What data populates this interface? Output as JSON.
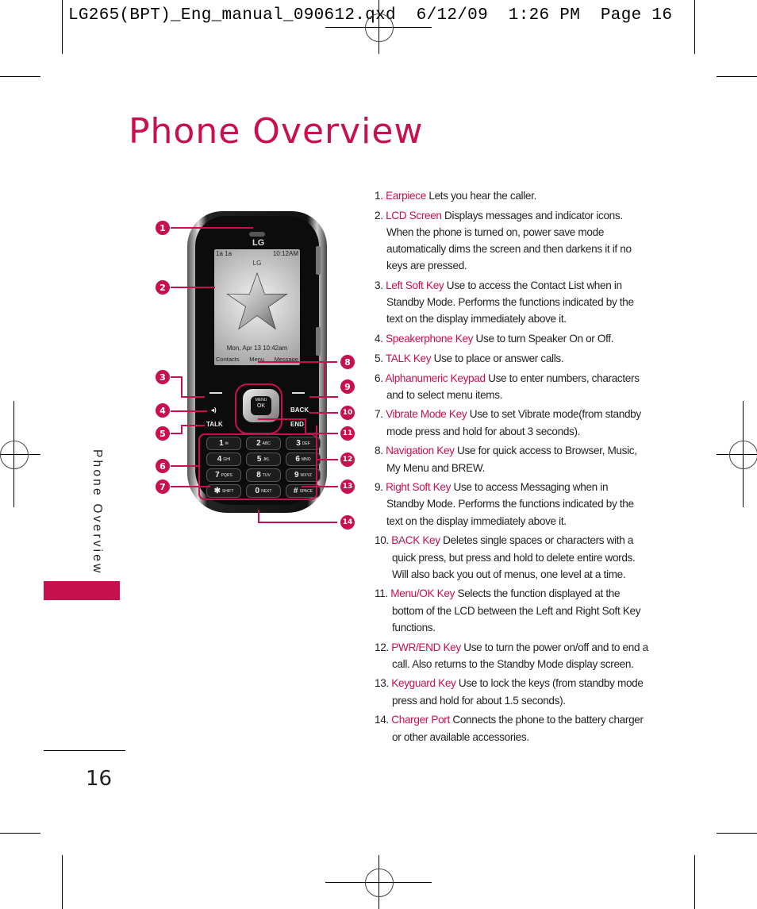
{
  "slug": "LG265(BPT)_Eng_manual_090612.qxd  6/12/09  1:26 PM  Page 16",
  "page": {
    "title": "Phone Overview",
    "side_label": "Phone Overview",
    "page_number": "16",
    "accent_color": "#c8104e"
  },
  "phone_screen": {
    "status_left": "1a  1a",
    "status_right": "10:12AM",
    "carrier": "LG",
    "date_time": "Mon, Apr 13   10:42am",
    "soft_left": "Contacts",
    "soft_center": "Menu",
    "soft_right": "Message",
    "logo": "LG"
  },
  "phone_keys": {
    "talk": "TALK",
    "back": "BACK",
    "end": "END",
    "ok_top": "MENU",
    "ok": "OK",
    "rows": [
      [
        {
          "d": "1",
          "l": "✉"
        },
        {
          "d": "2",
          "l": "ABC"
        },
        {
          "d": "3",
          "l": "DEF"
        }
      ],
      [
        {
          "d": "4",
          "l": "GHI"
        },
        {
          "d": "5",
          "l": "JKL"
        },
        {
          "d": "6",
          "l": "MNO"
        }
      ],
      [
        {
          "d": "7",
          "l": "PQRS"
        },
        {
          "d": "8",
          "l": "TUV"
        },
        {
          "d": "9",
          "l": "WXYZ"
        }
      ],
      [
        {
          "d": "✱",
          "l": "SHIFT"
        },
        {
          "d": "0",
          "l": "NEXT"
        },
        {
          "d": "#",
          "l": "SPACE"
        }
      ]
    ]
  },
  "callouts": [
    "1",
    "2",
    "3",
    "4",
    "5",
    "6",
    "7",
    "8",
    "9",
    "10",
    "11",
    "12",
    "13",
    "14"
  ],
  "items": [
    {
      "num": "1.",
      "term": "Earpiece",
      "desc": " Lets you hear the caller."
    },
    {
      "num": "2.",
      "term": "LCD Screen",
      "desc": " Displays messages and indicator icons. When the phone is turned on, power save mode automatically dims the screen and then darkens it if no keys are pressed."
    },
    {
      "num": "3.",
      "term": "Left Soft Key",
      "desc": " Use to access the Contact List when in Standby Mode. Performs the functions indicated by the text on the display immediately above it."
    },
    {
      "num": "4.",
      "term": "Speakerphone Key",
      "desc": " Use to turn Speaker On or Off."
    },
    {
      "num": "5.",
      "term": "TALK Key",
      "desc": " Use to place or answer calls."
    },
    {
      "num": "6.",
      "term": "Alphanumeric Keypad",
      "desc": " Use to enter numbers, characters and to select menu items."
    },
    {
      "num": "7.",
      "term": "Vibrate Mode Key",
      "desc": " Use to set Vibrate mode(from standby mode press and hold for about 3 seconds)."
    },
    {
      "num": "8.",
      "term": "Navigation Key",
      "desc": " Use for quick access to Browser, Music, My Menu and BREW."
    },
    {
      "num": "9.",
      "term": "Right Soft Key",
      "desc": " Use to access Messaging when in Standby Mode. Performs the functions indicated by the text on the display immediately above it."
    },
    {
      "num": "10.",
      "term": "BACK Key",
      "desc": " Deletes single spaces or characters with a quick press, but press and hold to delete entire words. Will also back you out of menus, one level at a time."
    },
    {
      "num": "11.",
      "term": "Menu/OK Key",
      "desc": " Selects the function displayed at the bottom of the LCD between the Left and Right Soft Key functions."
    },
    {
      "num": "12.",
      "term": "PWR/END Key",
      "desc": " Use to turn the power on/off and to end a call. Also returns to the Standby Mode display screen."
    },
    {
      "num": "13.",
      "term": "Keyguard Key",
      "desc": " Use to lock the keys (from standby mode press and hold for about 1.5 seconds)."
    },
    {
      "num": "14.",
      "term": "Charger Port",
      "desc": " Connects the phone to the battery charger or other available accessories."
    }
  ]
}
